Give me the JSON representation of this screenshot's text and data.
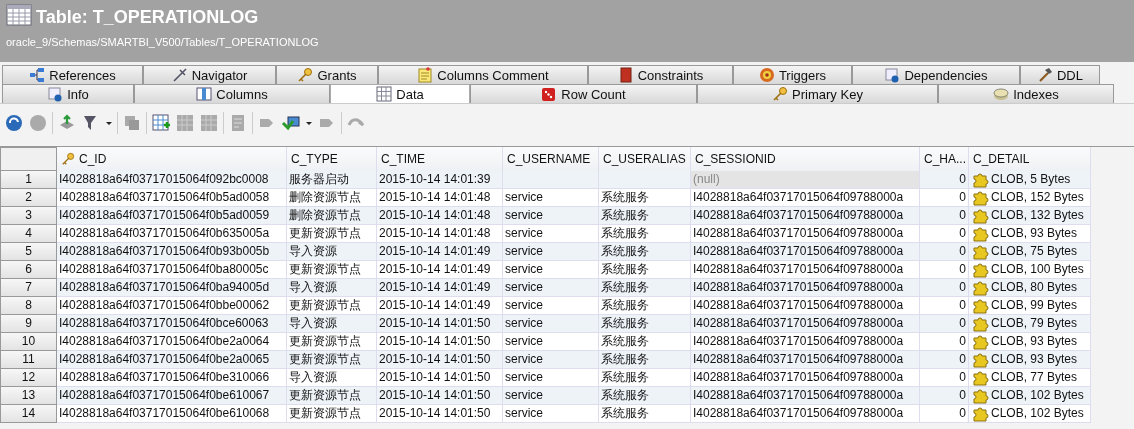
{
  "window": {
    "title": "Table: T_OPERATIONLOG",
    "path": "oracle_9/Schemas/SMARTBI_V500/Tables/T_OPERATIONLOG"
  },
  "tab_rows": [
    [
      {
        "label": "References",
        "selected": false
      },
      {
        "label": "Navigator",
        "selected": false
      },
      {
        "label": "Grants",
        "selected": false
      },
      {
        "label": "Columns Comment",
        "selected": false
      },
      {
        "label": "Constraints",
        "selected": false
      },
      {
        "label": "Triggers",
        "selected": false
      },
      {
        "label": "Dependencies",
        "selected": false
      },
      {
        "label": "DDL",
        "selected": false
      }
    ],
    [
      {
        "label": "Info",
        "selected": false
      },
      {
        "label": "Columns",
        "selected": false
      },
      {
        "label": "Data",
        "selected": true
      },
      {
        "label": "Row Count",
        "selected": false
      },
      {
        "label": "Primary Key",
        "selected": false
      },
      {
        "label": "Indexes",
        "selected": false
      }
    ]
  ],
  "table": {
    "columns": [
      {
        "label": "C_ID",
        "primary_key": true
      },
      {
        "label": "C_TYPE",
        "primary_key": false
      },
      {
        "label": "C_TIME",
        "primary_key": false
      },
      {
        "label": "C_USERNAME",
        "primary_key": false
      },
      {
        "label": "C_USERALIAS",
        "primary_key": false
      },
      {
        "label": "C_SESSIONID",
        "primary_key": false
      },
      {
        "label": "C_HA...",
        "primary_key": false
      },
      {
        "label": "C_DETAIL",
        "primary_key": false
      }
    ],
    "rows": [
      {
        "num": "1",
        "id": "I4028818a64f03717015064f092bc0008",
        "type": "服务器启动",
        "time": "2015-10-14 14:01:39",
        "username": "",
        "useralias": "",
        "sessionid": "(null)",
        "sessionid_null": true,
        "ha": "0",
        "detail": "CLOB, 5 Bytes"
      },
      {
        "num": "2",
        "id": "I4028818a64f03717015064f0b5ad0058",
        "type": "删除资源节点",
        "time": "2015-10-14 14:01:48",
        "username": "service",
        "useralias": "系统服务",
        "sessionid": "I4028818a64f03717015064f09788000a",
        "sessionid_null": false,
        "ha": "0",
        "detail": "CLOB, 152 Bytes"
      },
      {
        "num": "3",
        "id": "I4028818a64f03717015064f0b5ad0059",
        "type": "删除资源节点",
        "time": "2015-10-14 14:01:48",
        "username": "service",
        "useralias": "系统服务",
        "sessionid": "I4028818a64f03717015064f09788000a",
        "sessionid_null": false,
        "ha": "0",
        "detail": "CLOB, 132 Bytes"
      },
      {
        "num": "4",
        "id": "I4028818a64f03717015064f0b635005a",
        "type": "更新资源节点",
        "time": "2015-10-14 14:01:48",
        "username": "service",
        "useralias": "系统服务",
        "sessionid": "I4028818a64f03717015064f09788000a",
        "sessionid_null": false,
        "ha": "0",
        "detail": "CLOB, 93 Bytes"
      },
      {
        "num": "5",
        "id": "I4028818a64f03717015064f0b93b005b",
        "type": "导入资源",
        "time": "2015-10-14 14:01:49",
        "username": "service",
        "useralias": "系统服务",
        "sessionid": "I4028818a64f03717015064f09788000a",
        "sessionid_null": false,
        "ha": "0",
        "detail": "CLOB, 75 Bytes"
      },
      {
        "num": "6",
        "id": "I4028818a64f03717015064f0ba80005c",
        "type": "更新资源节点",
        "time": "2015-10-14 14:01:49",
        "username": "service",
        "useralias": "系统服务",
        "sessionid": "I4028818a64f03717015064f09788000a",
        "sessionid_null": false,
        "ha": "0",
        "detail": "CLOB, 100 Bytes"
      },
      {
        "num": "7",
        "id": "I4028818a64f03717015064f0ba94005d",
        "type": "导入资源",
        "time": "2015-10-14 14:01:49",
        "username": "service",
        "useralias": "系统服务",
        "sessionid": "I4028818a64f03717015064f09788000a",
        "sessionid_null": false,
        "ha": "0",
        "detail": "CLOB, 80 Bytes"
      },
      {
        "num": "8",
        "id": "I4028818a64f03717015064f0bbe00062",
        "type": "更新资源节点",
        "time": "2015-10-14 14:01:49",
        "username": "service",
        "useralias": "系统服务",
        "sessionid": "I4028818a64f03717015064f09788000a",
        "sessionid_null": false,
        "ha": "0",
        "detail": "CLOB, 99 Bytes"
      },
      {
        "num": "9",
        "id": "I4028818a64f03717015064f0bce60063",
        "type": "导入资源",
        "time": "2015-10-14 14:01:50",
        "username": "service",
        "useralias": "系统服务",
        "sessionid": "I4028818a64f03717015064f09788000a",
        "sessionid_null": false,
        "ha": "0",
        "detail": "CLOB, 79 Bytes"
      },
      {
        "num": "10",
        "id": "I4028818a64f03717015064f0be2a0064",
        "type": "更新资源节点",
        "time": "2015-10-14 14:01:50",
        "username": "service",
        "useralias": "系统服务",
        "sessionid": "I4028818a64f03717015064f09788000a",
        "sessionid_null": false,
        "ha": "0",
        "detail": "CLOB, 93 Bytes"
      },
      {
        "num": "11",
        "id": "I4028818a64f03717015064f0be2a0065",
        "type": "更新资源节点",
        "time": "2015-10-14 14:01:50",
        "username": "service",
        "useralias": "系统服务",
        "sessionid": "I4028818a64f03717015064f09788000a",
        "sessionid_null": false,
        "ha": "0",
        "detail": "CLOB, 93 Bytes"
      },
      {
        "num": "12",
        "id": "I4028818a64f03717015064f0be310066",
        "type": "导入资源",
        "time": "2015-10-14 14:01:50",
        "username": "service",
        "useralias": "系统服务",
        "sessionid": "I4028818a64f03717015064f09788000a",
        "sessionid_null": false,
        "ha": "0",
        "detail": "CLOB, 77 Bytes"
      },
      {
        "num": "13",
        "id": "I4028818a64f03717015064f0be610067",
        "type": "更新资源节点",
        "time": "2015-10-14 14:01:50",
        "username": "service",
        "useralias": "系统服务",
        "sessionid": "I4028818a64f03717015064f09788000a",
        "sessionid_null": false,
        "ha": "0",
        "detail": "CLOB, 102 Bytes"
      },
      {
        "num": "14",
        "id": "I4028818a64f03717015064f0be610068",
        "type": "更新资源节点",
        "time": "2015-10-14 14:01:50",
        "username": "service",
        "useralias": "系统服务",
        "sessionid": "I4028818a64f03717015064f09788000a",
        "sessionid_null": false,
        "ha": "0",
        "detail": "CLOB, 102 Bytes"
      }
    ]
  }
}
